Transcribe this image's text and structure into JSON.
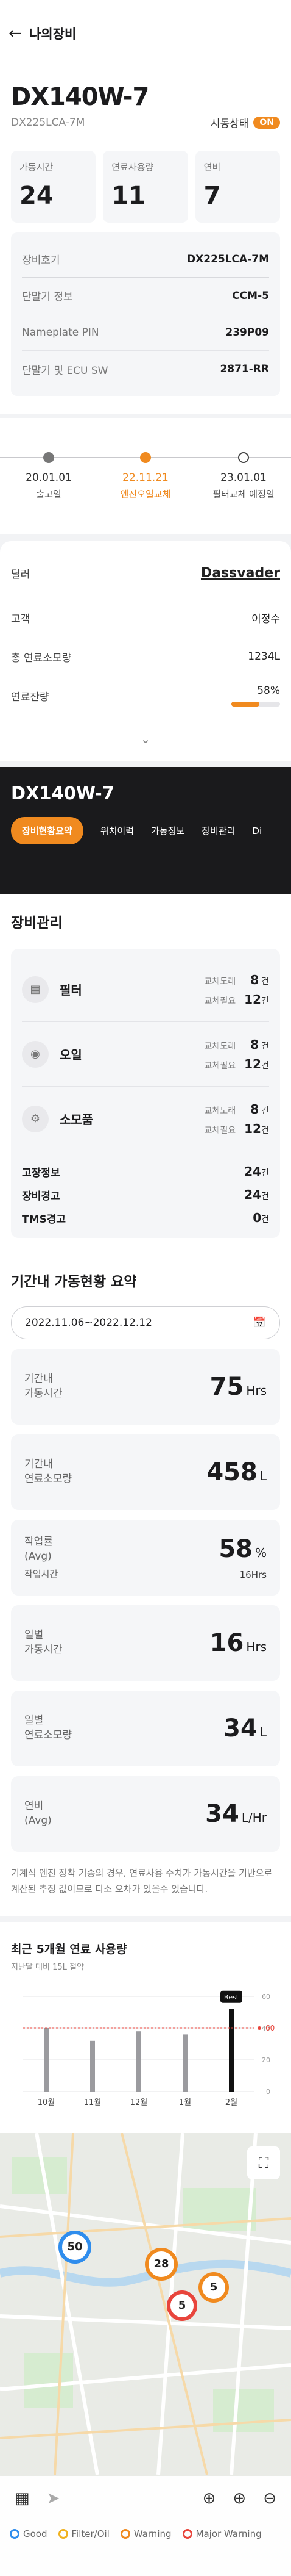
{
  "header": {
    "back_icon": "arrow-left-icon",
    "title": "나의장비"
  },
  "equipment": {
    "model": "DX140W-7",
    "code": "DX225LCA-7M",
    "status_label": "시동상태",
    "status_value": "ON",
    "stats": [
      {
        "label": "가동시간",
        "value": "24"
      },
      {
        "label": "연료사용량",
        "value": "11"
      },
      {
        "label": "연비",
        "value": "7"
      }
    ],
    "info": [
      {
        "key": "장비호기",
        "value": "DX225LCA-7M"
      },
      {
        "key": "단말기 정보",
        "value": "CCM-5"
      },
      {
        "key": "Nameplate PIN",
        "value": "239P09"
      },
      {
        "key": "단말기 및 ECU SW",
        "value": "2871-RR"
      }
    ]
  },
  "timeline": [
    {
      "date": "20.01.01",
      "label": "출고일",
      "state": "past"
    },
    {
      "date": "22.11.21",
      "label": "엔진오일교체",
      "state": "active"
    },
    {
      "date": "23.01.01",
      "label": "필터교체 예정일",
      "state": "future"
    }
  ],
  "dealer": {
    "rows": [
      {
        "key": "딜러",
        "value": "Dassvader"
      },
      {
        "key": "고객",
        "value": "이정수"
      },
      {
        "key": "총 연료소모량",
        "value": "1234L"
      },
      {
        "key": "연료잔량",
        "value": "58%"
      }
    ],
    "fuel_level": 0.58,
    "expand_icon": "chevron-down-icon"
  },
  "dark_panel": {
    "model": "DX140W-7",
    "tabs": [
      "장비현황요약",
      "위치이력",
      "가동정보",
      "장비관리",
      "Di"
    ]
  },
  "management": {
    "title": "장비관리",
    "items": [
      {
        "name": "필터",
        "icon": "filter-icon",
        "replace_warn_label": "교체도래",
        "replace_warn": "8",
        "replace_need_label": "교체필요",
        "replace_need": "12",
        "unit": "건"
      },
      {
        "name": "오일",
        "icon": "oil-icon",
        "replace_warn_label": "교체도래",
        "replace_warn": "8",
        "replace_need_label": "교체필요",
        "replace_need": "12",
        "unit": "건"
      },
      {
        "name": "소모품",
        "icon": "parts-icon",
        "replace_warn_label": "교체도래",
        "replace_warn": "8",
        "replace_need_label": "교체필요",
        "replace_need": "12",
        "unit": "건"
      }
    ],
    "alerts": [
      {
        "key": "고장정보",
        "value": "24",
        "unit": "건"
      },
      {
        "key": "장비경고",
        "value": "24",
        "unit": "건"
      },
      {
        "key": "TMS경고",
        "value": "0",
        "unit": "건"
      }
    ]
  },
  "summary": {
    "title": "기간내 가동현황 요약",
    "date_range": "2022.11.06~2022.12.12",
    "calendar_icon": "calendar-icon",
    "cards": [
      {
        "label": "기간내\n가동시간",
        "value": "75",
        "unit": "Hrs"
      },
      {
        "label": "기간내\n연료소모량",
        "value": "458",
        "unit": "L"
      },
      {
        "label": "작업률\n(Avg)",
        "value": "58",
        "unit": "%",
        "sub_label": "작업시간",
        "sub_value": "16Hrs"
      },
      {
        "label": "일별\n가동시간",
        "value": "16",
        "unit": "Hrs"
      },
      {
        "label": "일별\n연료소모량",
        "value": "34",
        "unit": "L"
      },
      {
        "label": "연비\n(Avg)",
        "value": "34",
        "unit": "L/Hr"
      }
    ],
    "note": "기계식 엔진 장착 기종의 경우, 연료사용 수치가 가동시간을 기반으로 계산된 추정 값이므로 다소 오차가 있을수 있습니다."
  },
  "chart_data": {
    "type": "bar",
    "title": "최근 5개월 연료 사용량",
    "subtitle": "지난달 대비 15L 절약",
    "categories": [
      "10월",
      "11월",
      "12월",
      "1월",
      "2월"
    ],
    "values": [
      40,
      32,
      38,
      36,
      52
    ],
    "ylim": [
      0,
      60
    ],
    "yticks": [
      0,
      20,
      40,
      60
    ],
    "highlight_index": 4,
    "highlight_label": "Best",
    "reference_line": 40,
    "reference_label": "60",
    "colors": {
      "bar": "#9b9b9f",
      "highlight": "#111111",
      "reference": "#e8453c"
    }
  },
  "map": {
    "clusters": [
      {
        "count": "50",
        "color": "#2f8ded"
      },
      {
        "count": "28",
        "color": "#f08a1f"
      },
      {
        "count": "5",
        "color": "#f08a1f"
      },
      {
        "count": "5",
        "color": "#e8453c"
      }
    ],
    "fullscreen_icon": "fullscreen-icon",
    "tools_left": [
      "map-icon",
      "location-off-icon"
    ],
    "tools_right": [
      "target-icon",
      "zoom-in-icon",
      "zoom-out-icon"
    ],
    "legend": [
      {
        "label": "Good",
        "color": "#2f8ded"
      },
      {
        "label": "Filter/Oil",
        "color": "#f0b21f"
      },
      {
        "label": "Warning",
        "color": "#f08a1f"
      },
      {
        "label": "Major Warning",
        "color": "#e8453c"
      }
    ]
  },
  "colors": {
    "accent": "#f08a1f",
    "dark": "#1a1a1c"
  }
}
